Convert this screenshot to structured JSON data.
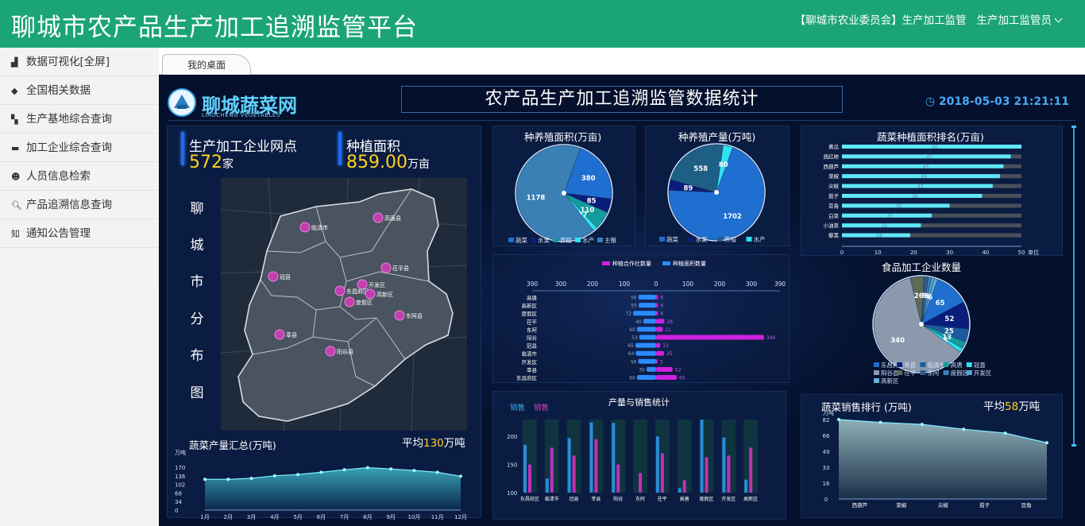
{
  "app": {
    "title": "聊城市农产品生产加工追溯监管平台",
    "user_org": "【聊城市农业委员会】生产加工监管",
    "user_role": "生产加工监管员"
  },
  "sidebar": {
    "items": [
      {
        "icon": "chart-icon",
        "label": "数据可视化[全屏]"
      },
      {
        "icon": "car-icon",
        "label": "全国相关数据"
      },
      {
        "icon": "building-icon",
        "label": "生产基地综合查询"
      },
      {
        "icon": "drive-icon",
        "label": "加工企业综合查询"
      },
      {
        "icon": "user-icon",
        "label": "人员信息检索"
      },
      {
        "icon": "search-icon",
        "label": "产品追溯信息查询"
      },
      {
        "icon": "notice-icon",
        "label": "通知公告管理"
      }
    ]
  },
  "tabs": [
    {
      "label": "我的桌面"
    }
  ],
  "dashboard": {
    "logo_text": "聊城蔬菜网",
    "logo_sub": "LIAOCHENG VEGETABLES",
    "title": "农产品生产加工追溯监管数据统计",
    "datetime": "2018-05-03 21:21:11",
    "stats": {
      "outlets_label": "生产加工企业网点",
      "outlets_value": "572",
      "outlets_unit": "家",
      "area_label": "种植面积",
      "area_value": "859.00",
      "area_unit": "万亩"
    },
    "map": {
      "vertical_title": [
        "聊",
        "城",
        "市",
        "分",
        "布",
        "图"
      ],
      "cities": [
        {
          "name": "临清市"
        },
        {
          "name": "高唐县"
        },
        {
          "name": "茌平县"
        },
        {
          "name": "冠县"
        },
        {
          "name": "开发区"
        },
        {
          "name": "东昌府区"
        },
        {
          "name": "高新区"
        },
        {
          "name": "度假区"
        },
        {
          "name": "东阿县"
        },
        {
          "name": "莘县"
        },
        {
          "name": "阳谷县"
        }
      ]
    },
    "veg_summary": {
      "title": "蔬菜产量汇总(万吨)",
      "avg_prefix": "平均",
      "avg_value": "130",
      "avg_unit": "万吨",
      "unit": "万吨",
      "yticks": [
        "170",
        "136",
        "102",
        "68",
        "34",
        "0"
      ]
    },
    "area_pie": {
      "title": "种养殖面积(万亩)",
      "legend": [
        "蔬菜",
        "水果",
        "养殖",
        "水产",
        "主粮"
      ]
    },
    "yield_pie": {
      "title": "种养殖产量(万吨)",
      "legend": [
        "蔬菜",
        "水果",
        "养殖",
        "水产"
      ]
    },
    "butterfly": {
      "legend_a": "种植合作社数量",
      "legend_b": "种植面积数量",
      "ticks": [
        "390",
        "300",
        "200",
        "100",
        "0",
        "100",
        "200",
        "300",
        "390"
      ]
    },
    "sales": {
      "title": "产量与销售统计",
      "legend_a": "销售",
      "legend_b": "销售",
      "yticks": [
        "200",
        "150",
        "100"
      ]
    },
    "veg_rank": {
      "title": "蔬菜种植面积排名(万亩)",
      "unit": "单位",
      "xticks": [
        "0",
        "10",
        "20",
        "30",
        "40",
        "50"
      ]
    },
    "food_pie": {
      "title": "食品加工企业数量",
      "legend": [
        "东昌府区",
        "莘县",
        "临清市",
        "高唐",
        "冠县",
        "阳谷县",
        "茌平",
        "东阿",
        "度假区",
        "开发区",
        "高新区"
      ]
    },
    "veg_sales": {
      "title": "蔬菜销售排行 (万吨)",
      "avg_prefix": "平均",
      "avg_value": "58",
      "avg_unit": "万吨",
      "unit": "万吨",
      "yticks": [
        "82",
        "66",
        "49",
        "33",
        "16",
        "0"
      ]
    }
  },
  "chart_data": [
    {
      "type": "pie",
      "title": "种养殖面积(万亩)",
      "labels": [
        "蔬菜",
        "水果",
        "养殖",
        "水产",
        "主粮"
      ],
      "values": [
        380,
        85,
        110,
        27,
        1178
      ],
      "colors": [
        "#1f6fd1",
        "#0b1d7a",
        "#159b9e",
        "#2de3f0",
        "#3a80b5"
      ]
    },
    {
      "type": "pie",
      "title": "种养殖产量(万吨)",
      "labels": [
        "蔬菜",
        "水果",
        "养殖",
        "水产"
      ],
      "values": [
        1702,
        89,
        558,
        80
      ],
      "colors": [
        "#1f6fd1",
        "#0b1d7a",
        "#1e5f85",
        "#2de3f0"
      ]
    },
    {
      "type": "line",
      "title": "蔬菜产量汇总(万吨)",
      "x": [
        "1月",
        "2月",
        "3月",
        "4月",
        "5月",
        "6月",
        "7月",
        "8月",
        "9月",
        "10月",
        "11月",
        "12月"
      ],
      "values": [
        122,
        122,
        126,
        136,
        141,
        150,
        160,
        168,
        163,
        157,
        150,
        134
      ],
      "ylim": [
        0,
        170
      ]
    },
    {
      "type": "bar",
      "title": "butterfly",
      "categories": [
        "高唐",
        "高新区",
        "度假区",
        "茌平",
        "东阿",
        "阳谷",
        "冠县",
        "临清市",
        "开发区",
        "莘县",
        "东昌府区"
      ],
      "series": [
        {
          "name": "种植合作社数量",
          "values": [
            56,
            55,
            72,
            40,
            60,
            53,
            65,
            64,
            56,
            30,
            60
          ]
        },
        {
          "name": "种植面积数量",
          "values": [
            6,
            6,
            6,
            26,
            21,
            340,
            13,
            25,
            5,
            52,
            65
          ]
        }
      ],
      "xlim": [
        -390,
        390
      ]
    },
    {
      "type": "bar",
      "title": "产量与销售统计",
      "categories": [
        "东昌府区",
        "临清市",
        "冠县",
        "莘县",
        "阳谷",
        "东阿",
        "茌平",
        "高唐",
        "度假区",
        "开发区",
        "高新区"
      ],
      "series": [
        {
          "name": "销售",
          "values": [
            185,
            125,
            197,
            225,
            224,
            0,
            200,
            108,
            230,
            198,
            123
          ]
        },
        {
          "name": "销售",
          "values": [
            150,
            180,
            166,
            195,
            150,
            135,
            170,
            122,
            163,
            166,
            180
          ]
        }
      ],
      "ylim": [
        100,
        230
      ]
    },
    {
      "type": "bar",
      "title": "蔬菜种植面积排名(万亩)",
      "categories": [
        "黄瓜",
        "西红柿",
        "西葫芦",
        "菜椒",
        "尖椒",
        "茄子",
        "豆角",
        "白菜",
        "小油菜",
        "藜蒿"
      ],
      "values": [
        50,
        47,
        45,
        44,
        42,
        39,
        30,
        25,
        22,
        19
      ],
      "xlim": [
        0,
        50
      ]
    },
    {
      "type": "pie",
      "title": "食品加工企业数量",
      "labels": [
        "东昌府区",
        "莘县",
        "临清市",
        "高唐",
        "冠县",
        "阳谷县",
        "茌平",
        "东阿",
        "度假区",
        "开发区",
        "高新区"
      ],
      "values": [
        65,
        52,
        25,
        13,
        8,
        340,
        26,
        8,
        6,
        6,
        6
      ],
      "colors": [
        "#1f6fd1",
        "#0b1d7a",
        "#1c5ba0",
        "#159b9e",
        "#2de3f0",
        "#8c99ad",
        "#5e6a55",
        "#2f5a88",
        "#3a80b5",
        "#4ea5d8",
        "#6ab0d8"
      ]
    },
    {
      "type": "area",
      "title": "蔬菜销售排行 (万吨)",
      "categories": [
        "西葫芦",
        "菜椒",
        "尖椒",
        "茄子",
        "豆角"
      ],
      "values": [
        82,
        79,
        77,
        72,
        68,
        58
      ],
      "ylim": [
        0,
        82
      ]
    }
  ]
}
